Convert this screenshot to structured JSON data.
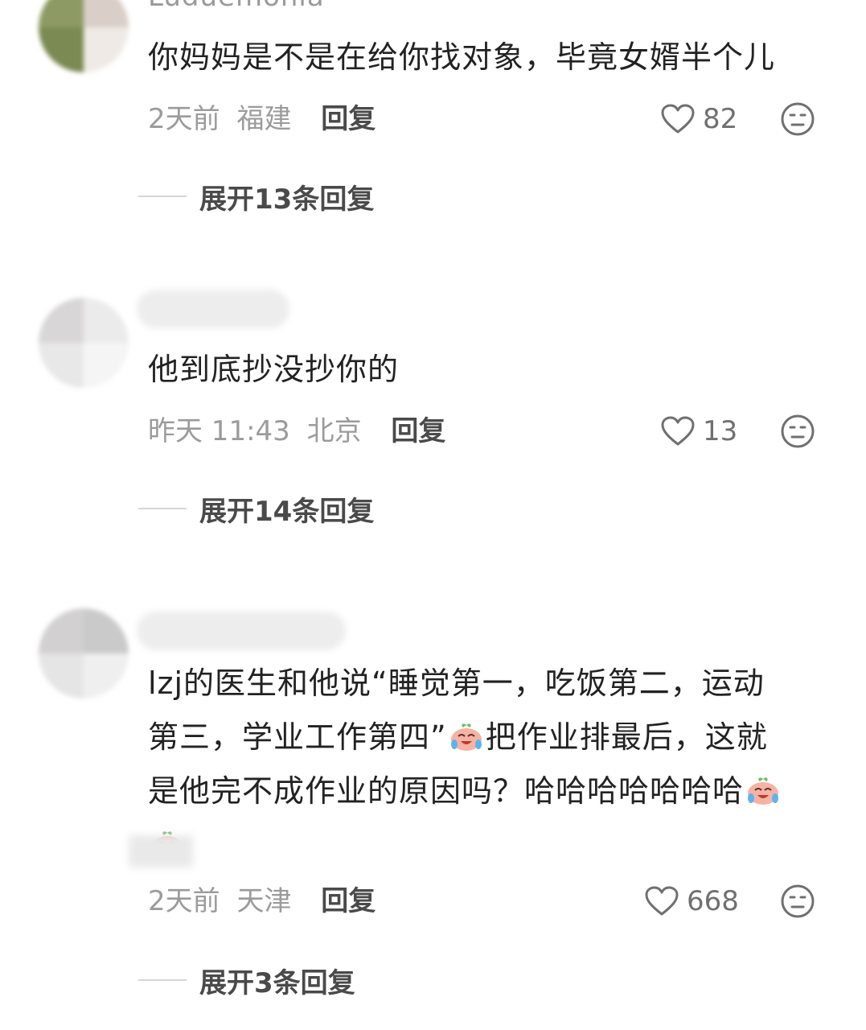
{
  "comments": [
    {
      "username": "Luduemonia",
      "content_parts": [
        {
          "t": "text",
          "v": "你妈妈是不是在给你找对象，毕竟女婿半个儿"
        }
      ],
      "time": "2天前",
      "location": "福建",
      "reply_label": "回复",
      "likes": "82",
      "expand_label": "展开13条回复"
    },
    {
      "username": "",
      "content_parts": [
        {
          "t": "text",
          "v": "他到底抄没抄你的"
        }
      ],
      "time": "昨天 11:43",
      "location": "北京",
      "reply_label": "回复",
      "likes": "13",
      "expand_label": "展开14条回复"
    },
    {
      "username": "",
      "content_lines": [
        "lzj的医生和他说“睡觉第一，吃饭第二，运动",
        "第三，学业工作第四”",
        "把作业排最后，这就",
        "是他完不成作业的原因吗？哈哈哈哈哈哈哈"
      ],
      "emoji_name": "crying-laughing-peach-emoji",
      "time": "2天前",
      "location": "天津",
      "reply_label": "回复",
      "likes": "668",
      "expand_label": "展开3条回复"
    }
  ],
  "icons": {
    "like": "heart-outline-icon",
    "dislike": "unhappy-face-icon"
  },
  "colors": {
    "text_main": "#222222",
    "text_meta": "#9b9b9b",
    "reply": "#4a4a4a",
    "divider": "#d6d6d6"
  }
}
